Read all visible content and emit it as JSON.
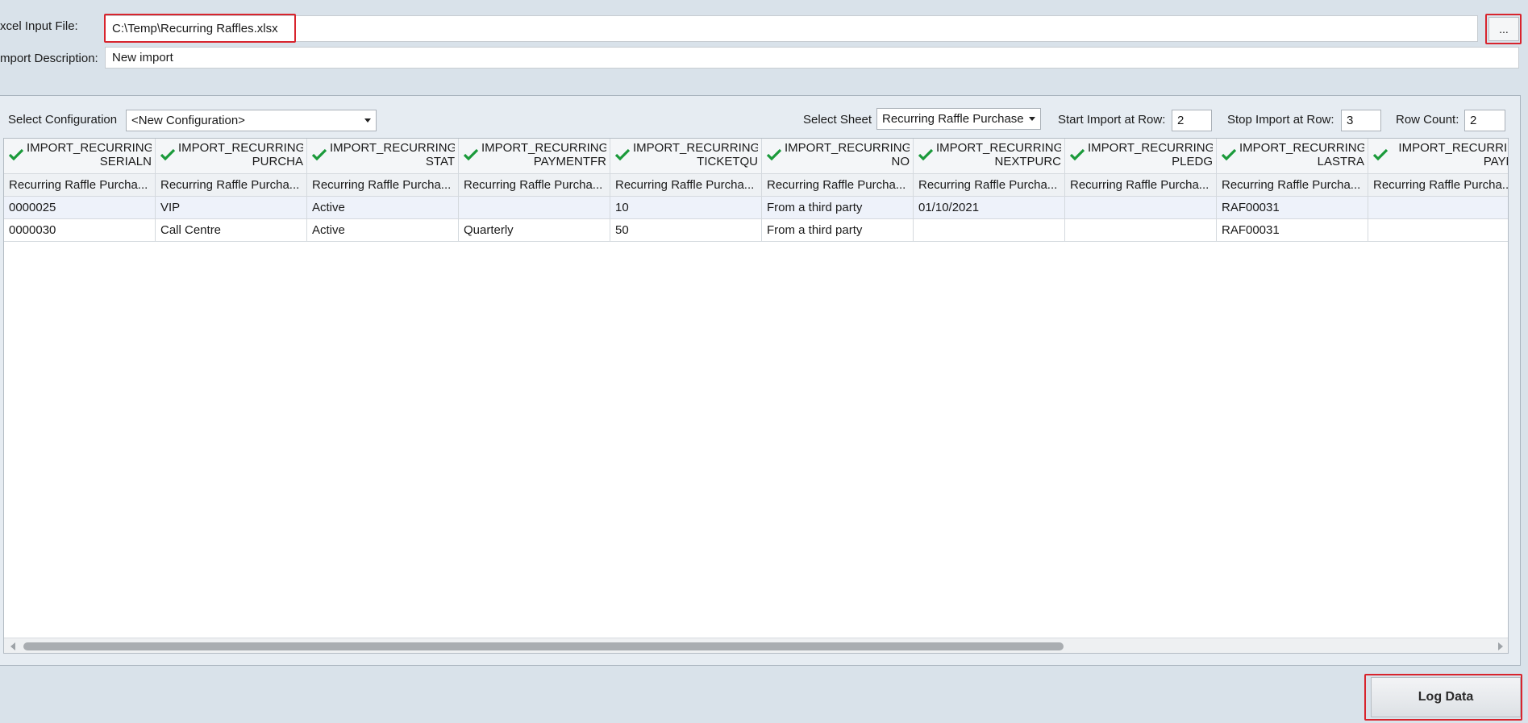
{
  "file": {
    "label": "xcel Input File:",
    "value": "C:\\Temp\\Recurring Raffles.xlsx",
    "browse_label": "..."
  },
  "description": {
    "label": "mport Description:",
    "value": "New import"
  },
  "config": {
    "label": "Select Configuration",
    "value": "<New Configuration>"
  },
  "sheet": {
    "label": "Select Sheet",
    "value": "Recurring Raffle Purchase"
  },
  "start_row": {
    "label": "Start Import at Row:",
    "value": "2"
  },
  "stop_row": {
    "label": "Stop Import at Row:",
    "value": "3"
  },
  "row_count": {
    "label": "Row Count:",
    "value": "2"
  },
  "grid": {
    "columns": [
      {
        "name": "IMPORT_RECURRING\nSERIALN",
        "mapped": "Recurring Raffle Purcha..."
      },
      {
        "name": "IMPORT_RECURRING\nPURCHA",
        "mapped": "Recurring Raffle Purcha..."
      },
      {
        "name": "IMPORT_RECURRING\nSTAT",
        "mapped": "Recurring Raffle Purcha..."
      },
      {
        "name": "IMPORT_RECURRING\nPAYMENTFR",
        "mapped": "Recurring Raffle Purcha..."
      },
      {
        "name": "IMPORT_RECURRING\nTICKETQU",
        "mapped": "Recurring Raffle Purcha..."
      },
      {
        "name": "IMPORT_RECURRING\nNO",
        "mapped": "Recurring Raffle Purcha..."
      },
      {
        "name": "IMPORT_RECURRING\nNEXTPURC",
        "mapped": "Recurring Raffle Purcha..."
      },
      {
        "name": "IMPORT_RECURRING\nPLEDG",
        "mapped": "Recurring Raffle Purcha..."
      },
      {
        "name": "IMPORT_RECURRING\nLASTRA",
        "mapped": "Recurring Raffle Purcha..."
      },
      {
        "name": "IMPORT_RECURRIN\nPAYM",
        "mapped": "Recurring Raffle Purcha..."
      }
    ],
    "rows": [
      [
        "0000025",
        "VIP",
        "Active",
        "",
        "10",
        "From a third party",
        "01/10/2021",
        "",
        "RAF00031",
        ""
      ],
      [
        "0000030",
        "Call Centre",
        "Active",
        "Quarterly",
        "50",
        "From a third party",
        "",
        "",
        "RAF00031",
        ""
      ]
    ]
  },
  "log_button": {
    "label": "Log Data"
  },
  "colors": {
    "highlight": "#d8242d",
    "check": "#1a9a3a",
    "background": "#d9e2ea"
  }
}
